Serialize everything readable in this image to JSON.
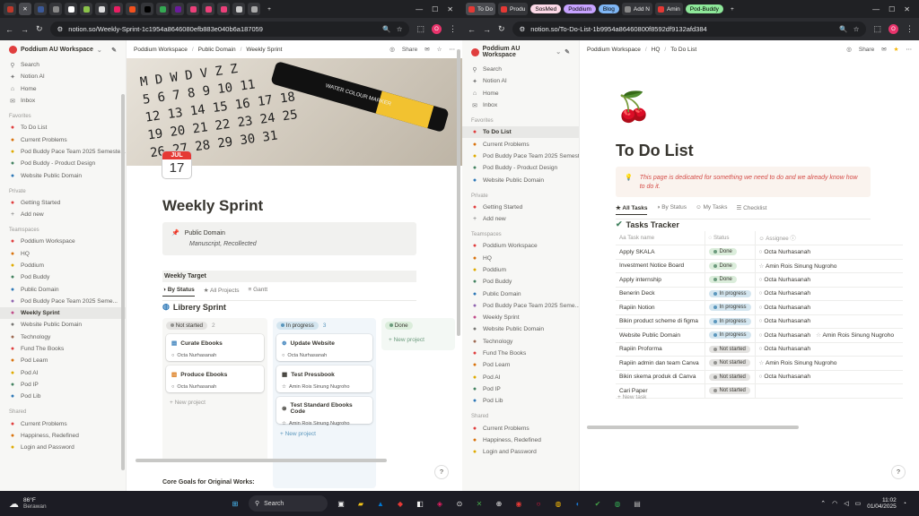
{
  "left": {
    "tabs": [
      "",
      "",
      "",
      "",
      "",
      "",
      "",
      "",
      "",
      "",
      "",
      "",
      "",
      "",
      "",
      "",
      ""
    ],
    "url": "notion.so/Weekly-Sprint-1c1954a8646080efb883e040b6a187059",
    "workspace": "Poddium AU Workspace",
    "breadcrumb": [
      "Poddium Workspace",
      "Public Domain",
      "Weekly Sprint"
    ],
    "share": "Share",
    "nav": [
      "Search",
      "Notion AI",
      "Home",
      "Inbox"
    ],
    "favorites_label": "Favorites",
    "favorites": [
      "To Do List",
      "Current Problems",
      "Pod Buddy Pace Team 2025 Semeste...",
      "Pod Buddy - Product Design",
      "Website Public Domain"
    ],
    "private_label": "Private",
    "private": [
      "Getting Started",
      "Add new"
    ],
    "teamspaces_label": "Teamspaces",
    "teamspaces": [
      "Poddium Workspace",
      "HQ",
      "Poddium",
      "Pod Buddy",
      "Public Domain",
      "Pod Buddy Pace Team 2025 Seme...",
      "Weekly Sprint",
      "Website Public Domain",
      "Technology",
      "Fund The Books",
      "Pod Learn",
      "Pod AI",
      "Pod IP",
      "Pod Lib"
    ],
    "shared_label": "Shared",
    "shared": [
      "Current Problems",
      "Happiness, Redefined",
      "Login and Password"
    ],
    "cover_grid": [
      "M D W D V Z Z",
      "5 6 7 8 9 10 11",
      "12 13 14 15 16 17 18",
      "19 20 21 22 23 24 25",
      "26 27 28 29 30 31"
    ],
    "marker_text": "WATER COLOUR MARKER",
    "cal_month": "JUL",
    "cal_day": "17",
    "title": "Weekly Sprint",
    "callout_title": "Public Domain",
    "callout_sub": "Manuscript, Recollected",
    "weekly_target": "Weekly Target",
    "views": [
      "By Status",
      "All Projects",
      "Gantt"
    ],
    "board_title": "Librery Sprint",
    "columns": [
      {
        "label": "Not started",
        "count": "2",
        "cards": [
          {
            "title": "Curate Ebooks",
            "person": "Octa Nurhasanah"
          },
          {
            "title": "Produce Ebooks",
            "person": "Octa Nurhasanah"
          }
        ]
      },
      {
        "label": "In progress",
        "count": "3",
        "cards": [
          {
            "title": "Update Website",
            "person": "Octa Nurhasanah"
          },
          {
            "title": "Test Pressbook",
            "person": "Amin Rois Sinung Nugroho"
          },
          {
            "title": "Test Standard Ebooks Code",
            "person": "Amin Rois Sinung Nugroho"
          }
        ]
      },
      {
        "label": "Done",
        "count": "",
        "cards": []
      }
    ],
    "new_project": "New project",
    "core_goals": "Core Goals for Original Works:"
  },
  "right": {
    "tabs": [
      "To Do",
      "Produ",
      "SosMed",
      "Poddium",
      "Blog",
      "Add N",
      "Amin",
      "Pod-Buddy"
    ],
    "url": "notion.so/To-Do-List-1b9954a86460800f8592df9132afd384",
    "workspace": "Poddium AU Workspace",
    "breadcrumb": [
      "Poddium Workspace",
      "HQ",
      "To Do List"
    ],
    "share": "Share",
    "page_icon": "🍒",
    "title": "To Do List",
    "callout": "This page is dedicated for something we need to do and we already know how to do it.",
    "views": [
      "All Tasks",
      "By Status",
      "My Tasks",
      "Checklist"
    ],
    "db_title": "Tasks Tracker",
    "headers": [
      "Task name",
      "Status",
      "Assignee"
    ],
    "rows": [
      {
        "task": "Apply SKALA",
        "status": "Done",
        "assignee": [
          "Octa Nurhasanah"
        ]
      },
      {
        "task": "Investment Notice Board",
        "status": "Done",
        "assignee": [
          "Amin Rois Sinung Nugroho"
        ]
      },
      {
        "task": "Apply internship",
        "status": "Done",
        "assignee": [
          "Octa Nurhasanah"
        ]
      },
      {
        "task": "Benerin Deck",
        "status": "In progress",
        "assignee": [
          "Octa Nurhasanah"
        ]
      },
      {
        "task": "Rapiin Notion",
        "status": "In progress",
        "assignee": [
          "Octa Nurhasanah"
        ]
      },
      {
        "task": "Bikin product scheme di figma",
        "status": "In progress",
        "assignee": [
          "Octa Nurhasanah"
        ]
      },
      {
        "task": "Website Public Domain",
        "status": "In progress",
        "assignee": [
          "Octa Nurhasanah",
          "Amin Rois Sinung Nugroho"
        ]
      },
      {
        "task": "Rapiin Proforma",
        "status": "Not started",
        "assignee": [
          "Octa Nurhasanah"
        ]
      },
      {
        "task": "Rapiin admin dan team Canva",
        "status": "Not started",
        "assignee": [
          "Amin Rois Sinung Nugroho"
        ]
      },
      {
        "task": "Bikin skema produk di Canva",
        "status": "Not started",
        "assignee": [
          "Octa Nurhasanah"
        ]
      },
      {
        "task": "Cari Paper",
        "status": "Not started",
        "assignee": []
      }
    ],
    "new_task": "New task"
  },
  "taskbar": {
    "weather_temp": "86°F",
    "weather_desc": "Berawan",
    "search": "Search",
    "time": "11:02",
    "date": "01/04/2025"
  },
  "colors": {
    "done_bg": "#dbeddb",
    "progress_bg": "#d3e5ef",
    "notstarted_bg": "#e3e2e0",
    "done_dot": "#6c9b7d",
    "progress_dot": "#5b97bd",
    "notstarted_dot": "#91918e"
  }
}
